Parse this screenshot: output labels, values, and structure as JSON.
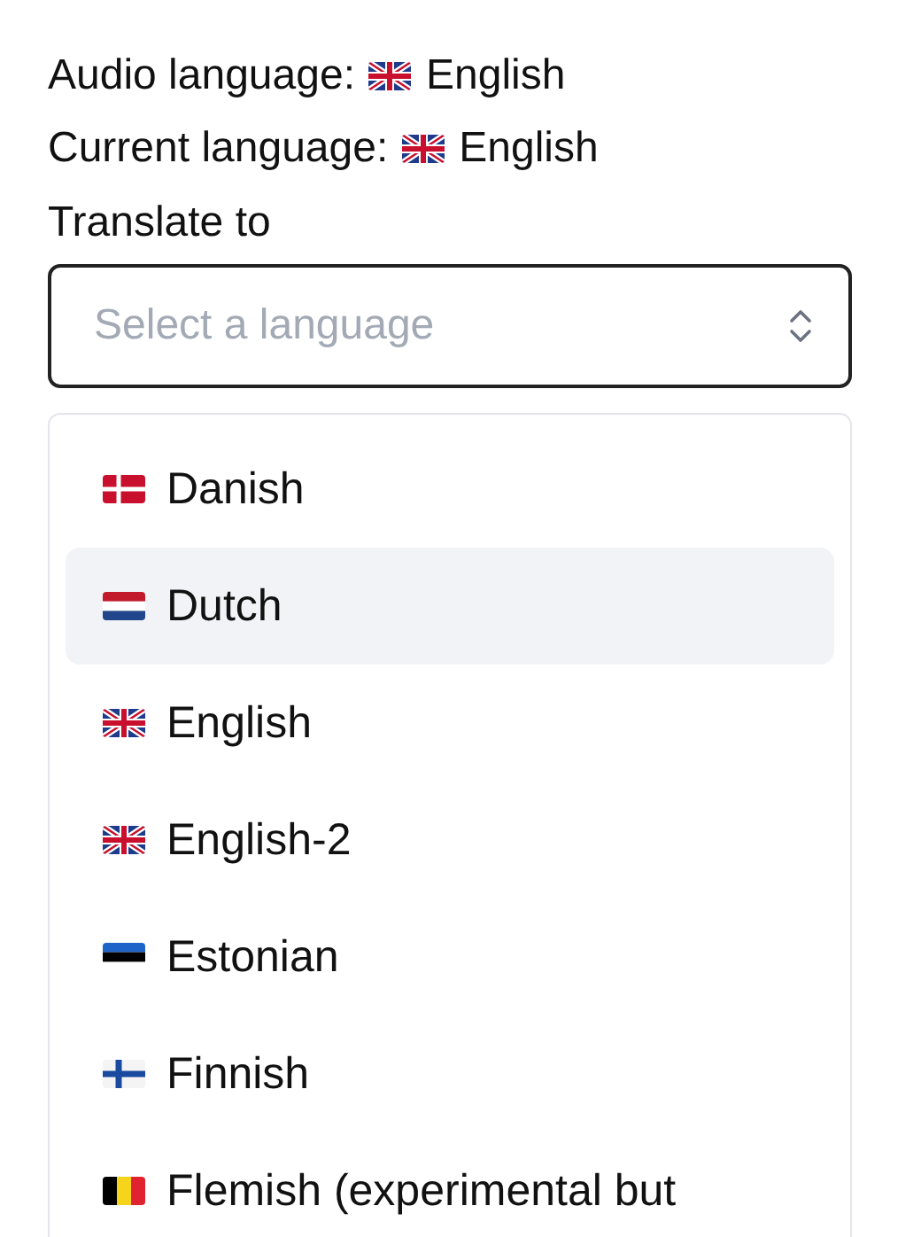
{
  "info": [
    {
      "label": "Audio language:",
      "kind": "uk",
      "value": "English"
    },
    {
      "label": "Current language:",
      "kind": "uk",
      "value": "English"
    }
  ],
  "translate": {
    "label": "Translate to",
    "placeholder": "Select a language"
  },
  "options": [
    {
      "label": "Danish",
      "kind": "denmark",
      "selected": false
    },
    {
      "label": "Dutch",
      "kind": "netherlands",
      "selected": true
    },
    {
      "label": "English",
      "kind": "uk",
      "selected": false
    },
    {
      "label": "English-2",
      "kind": "uk",
      "selected": false
    },
    {
      "label": "Estonian",
      "kind": "estonia",
      "selected": false
    },
    {
      "label": "Finnish",
      "kind": "finland",
      "selected": false
    },
    {
      "label": "Flemish (experimental but",
      "kind": "belgium",
      "selected": false
    }
  ]
}
